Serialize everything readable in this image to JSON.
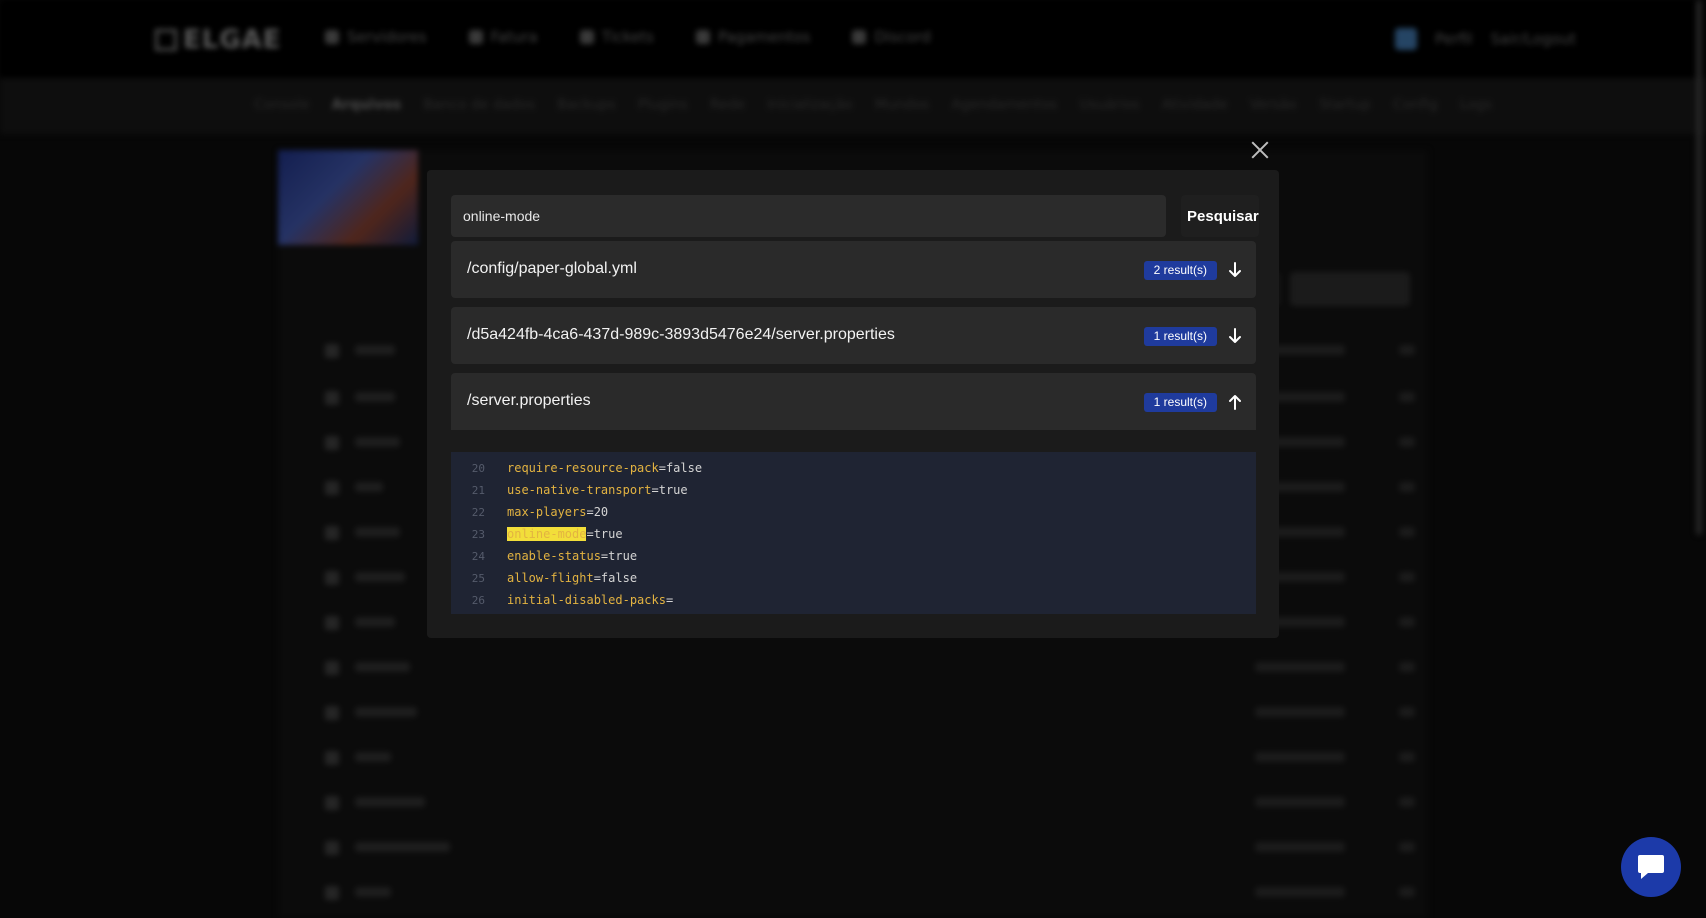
{
  "background": {
    "logo_text": "ELGAE",
    "nav_items": [
      "Servidores",
      "Fatura",
      "Tickets",
      "Pagamentos",
      "Discord"
    ],
    "user_items": [
      "Perfil",
      "Sair/Logout"
    ],
    "subnav_items": [
      "Console",
      "Arquivos",
      "Banco de dados",
      "Backups",
      "Plugins",
      "Rede",
      "Inicialização",
      "Mundos",
      "Agendamentos",
      "Usuários",
      "Atividade",
      "Versão",
      "Startup",
      "Config",
      "Logs"
    ],
    "subnav_active": "Arquivos"
  },
  "modal": {
    "search": {
      "value": "online-mode",
      "button_label": "Pesquisar"
    },
    "results": [
      {
        "path": "/config/paper-global.yml",
        "count_label": "2 result(s)",
        "expanded": false
      },
      {
        "path": "/d5a424fb-4ca6-437d-989c-3893d5476e24/server.properties",
        "count_label": "1 result(s)",
        "expanded": false
      },
      {
        "path": "/server.properties",
        "count_label": "1 result(s)",
        "expanded": true
      }
    ],
    "code_lines": [
      {
        "num": "20",
        "key": "require-resource-pack",
        "value": "=false",
        "highlight": false
      },
      {
        "num": "21",
        "key": "use-native-transport",
        "value": "=true",
        "highlight": false
      },
      {
        "num": "22",
        "key": "max-players",
        "value": "=20",
        "highlight": false
      },
      {
        "num": "23",
        "key": "online-mode",
        "value": "=true",
        "highlight": true
      },
      {
        "num": "24",
        "key": "enable-status",
        "value": "=true",
        "highlight": false
      },
      {
        "num": "25",
        "key": "allow-flight",
        "value": "=false",
        "highlight": false
      },
      {
        "num": "26",
        "key": "initial-disabled-packs",
        "value": "=",
        "highlight": false
      }
    ]
  },
  "colors": {
    "badge": "#1f3b9d",
    "chat_button": "#1c3aa9",
    "code_key": "#e3b341",
    "highlight": "#f2de3a"
  },
  "icons": {
    "close": "close-icon",
    "collapsed": "arrow-down-icon",
    "expanded": "arrow-up-icon",
    "chat": "chat-icon"
  }
}
